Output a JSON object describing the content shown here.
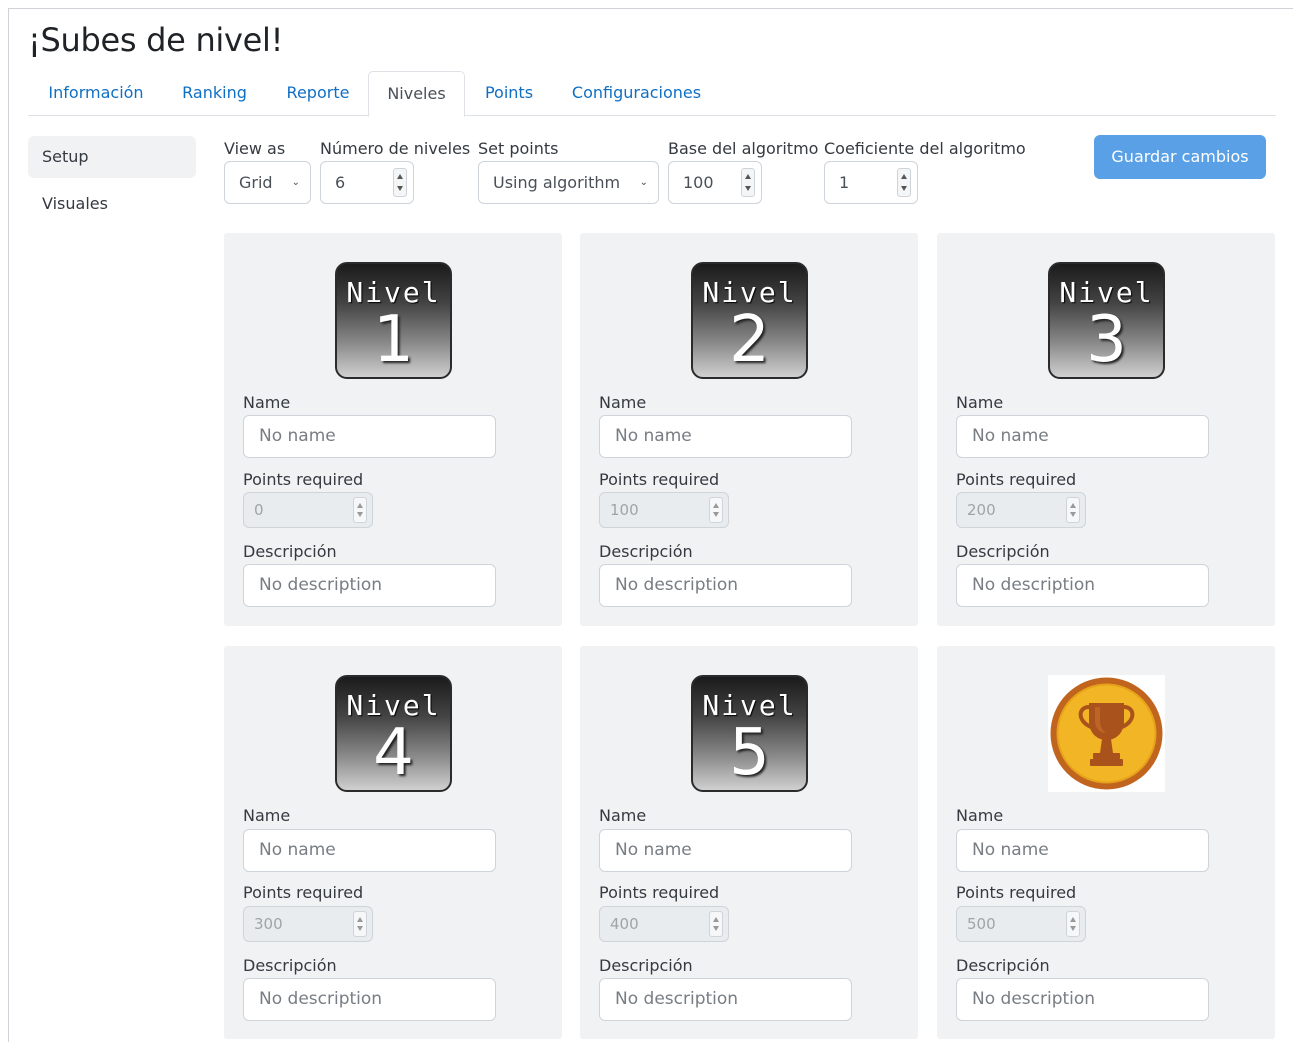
{
  "page": {
    "title": "¡Subes de nivel!"
  },
  "tabs": [
    {
      "label": "Información"
    },
    {
      "label": "Ranking"
    },
    {
      "label": "Reporte"
    },
    {
      "label": "Niveles"
    },
    {
      "label": "Points"
    },
    {
      "label": "Configuraciones"
    }
  ],
  "active_tab": "Niveles",
  "sidebar": {
    "items": [
      {
        "label": "Setup"
      },
      {
        "label": "Visuales"
      }
    ],
    "active": "Setup"
  },
  "controls": {
    "view_as": {
      "label": "View as",
      "value": "Grid"
    },
    "num_levels": {
      "label": "Número de niveles",
      "value": "6"
    },
    "set_points": {
      "label": "Set points",
      "value": "Using algorithm"
    },
    "algo_base": {
      "label": "Base del algoritmo",
      "value": "100"
    },
    "algo_coef": {
      "label": "Coeficiente del algoritmo",
      "value": "1"
    },
    "save_label": "Guardar cambios"
  },
  "field_labels": {
    "name": "Name",
    "points": "Points required",
    "description": "Descripción"
  },
  "levels": [
    {
      "badge_word": "Nivel",
      "badge_number": "1",
      "name_placeholder": "No name",
      "points": "0",
      "desc_placeholder": "No description"
    },
    {
      "badge_word": "Nivel",
      "badge_number": "2",
      "name_placeholder": "No name",
      "points": "100",
      "desc_placeholder": "No description"
    },
    {
      "badge_word": "Nivel",
      "badge_number": "3",
      "name_placeholder": "No name",
      "points": "200",
      "desc_placeholder": "No description"
    },
    {
      "badge_word": "Nivel",
      "badge_number": "4",
      "name_placeholder": "No name",
      "points": "300",
      "desc_placeholder": "No description"
    },
    {
      "badge_word": "Nivel",
      "badge_number": "5",
      "name_placeholder": "No name",
      "points": "400",
      "desc_placeholder": "No description"
    },
    {
      "badge_icon": "trophy-icon",
      "name_placeholder": "No name",
      "points": "500",
      "desc_placeholder": "No description"
    }
  ],
  "colors": {
    "link": "#0f6fc5",
    "primary_button": "#5aa0e6",
    "card_bg": "#f1f2f4",
    "trophy_ring": "#c0641e",
    "trophy_gold": "#f2b526"
  }
}
